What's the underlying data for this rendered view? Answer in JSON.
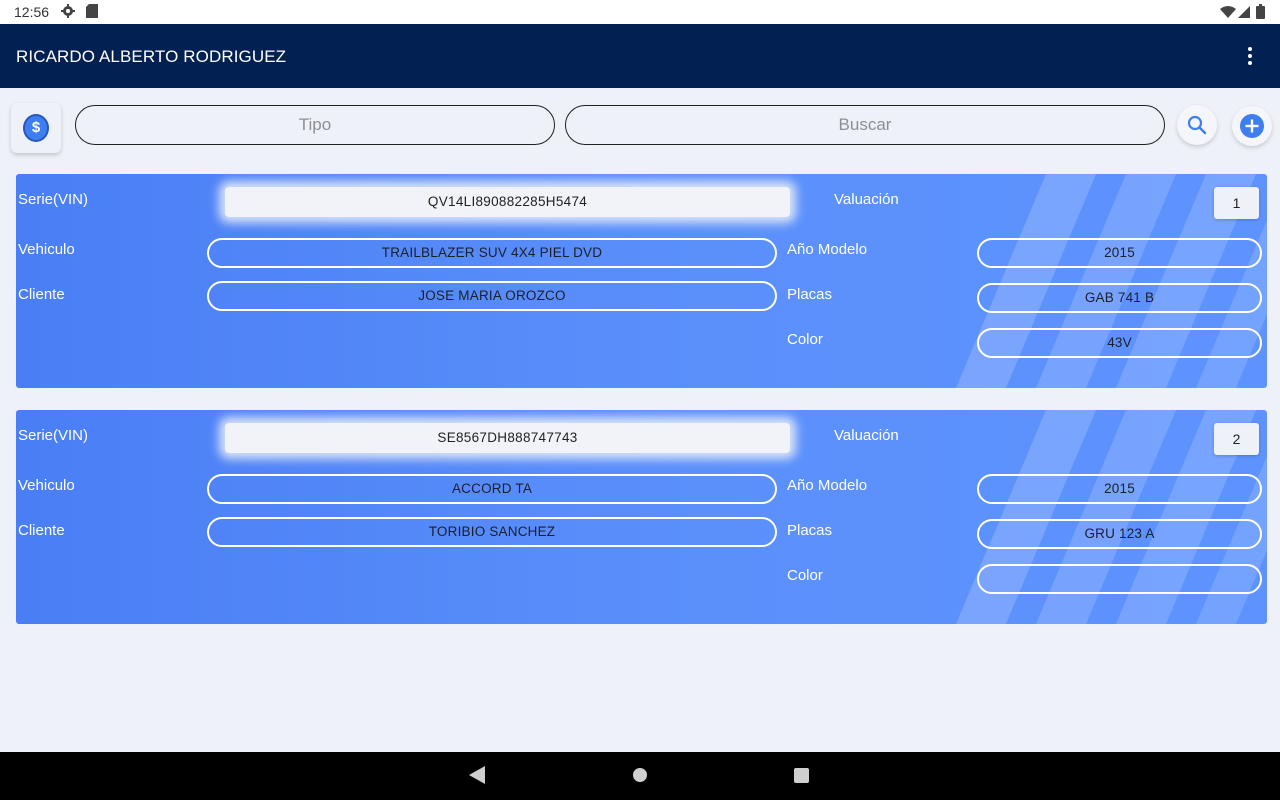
{
  "status_bar": {
    "time": "12:56"
  },
  "app_bar": {
    "title": "RICARDO ALBERTO RODRIGUEZ"
  },
  "toolbar": {
    "currency_symbol": "$",
    "tipo_placeholder": "Tipo",
    "buscar_placeholder": "Buscar"
  },
  "labels": {
    "serie": "Serie(VIN)",
    "vehiculo": "Vehiculo",
    "cliente": "Cliente",
    "valuacion": "Valuación",
    "anio": "Año Modelo",
    "placas": "Placas",
    "color": "Color"
  },
  "cards": [
    {
      "vin": "QV14LI890882285H5474",
      "vehiculo": "TRAILBLAZER SUV 4X4 PIEL DVD",
      "cliente": "JOSE MARIA OROZCO",
      "valuacion": "1",
      "anio": "2015",
      "placas": "GAB 741 B",
      "color": "43V"
    },
    {
      "vin": "SE8567DH888747743",
      "vehiculo": "ACCORD TA",
      "cliente": "TORIBIO SANCHEZ",
      "valuacion": "2",
      "anio": "2015",
      "placas": "GRU 123 A",
      "color": ""
    }
  ],
  "colors": {
    "app_bar": "#022052",
    "card_gradient_start": "#4a7ef5",
    "card_gradient_end": "#5e93ff",
    "accent": "#3f7ef0"
  }
}
